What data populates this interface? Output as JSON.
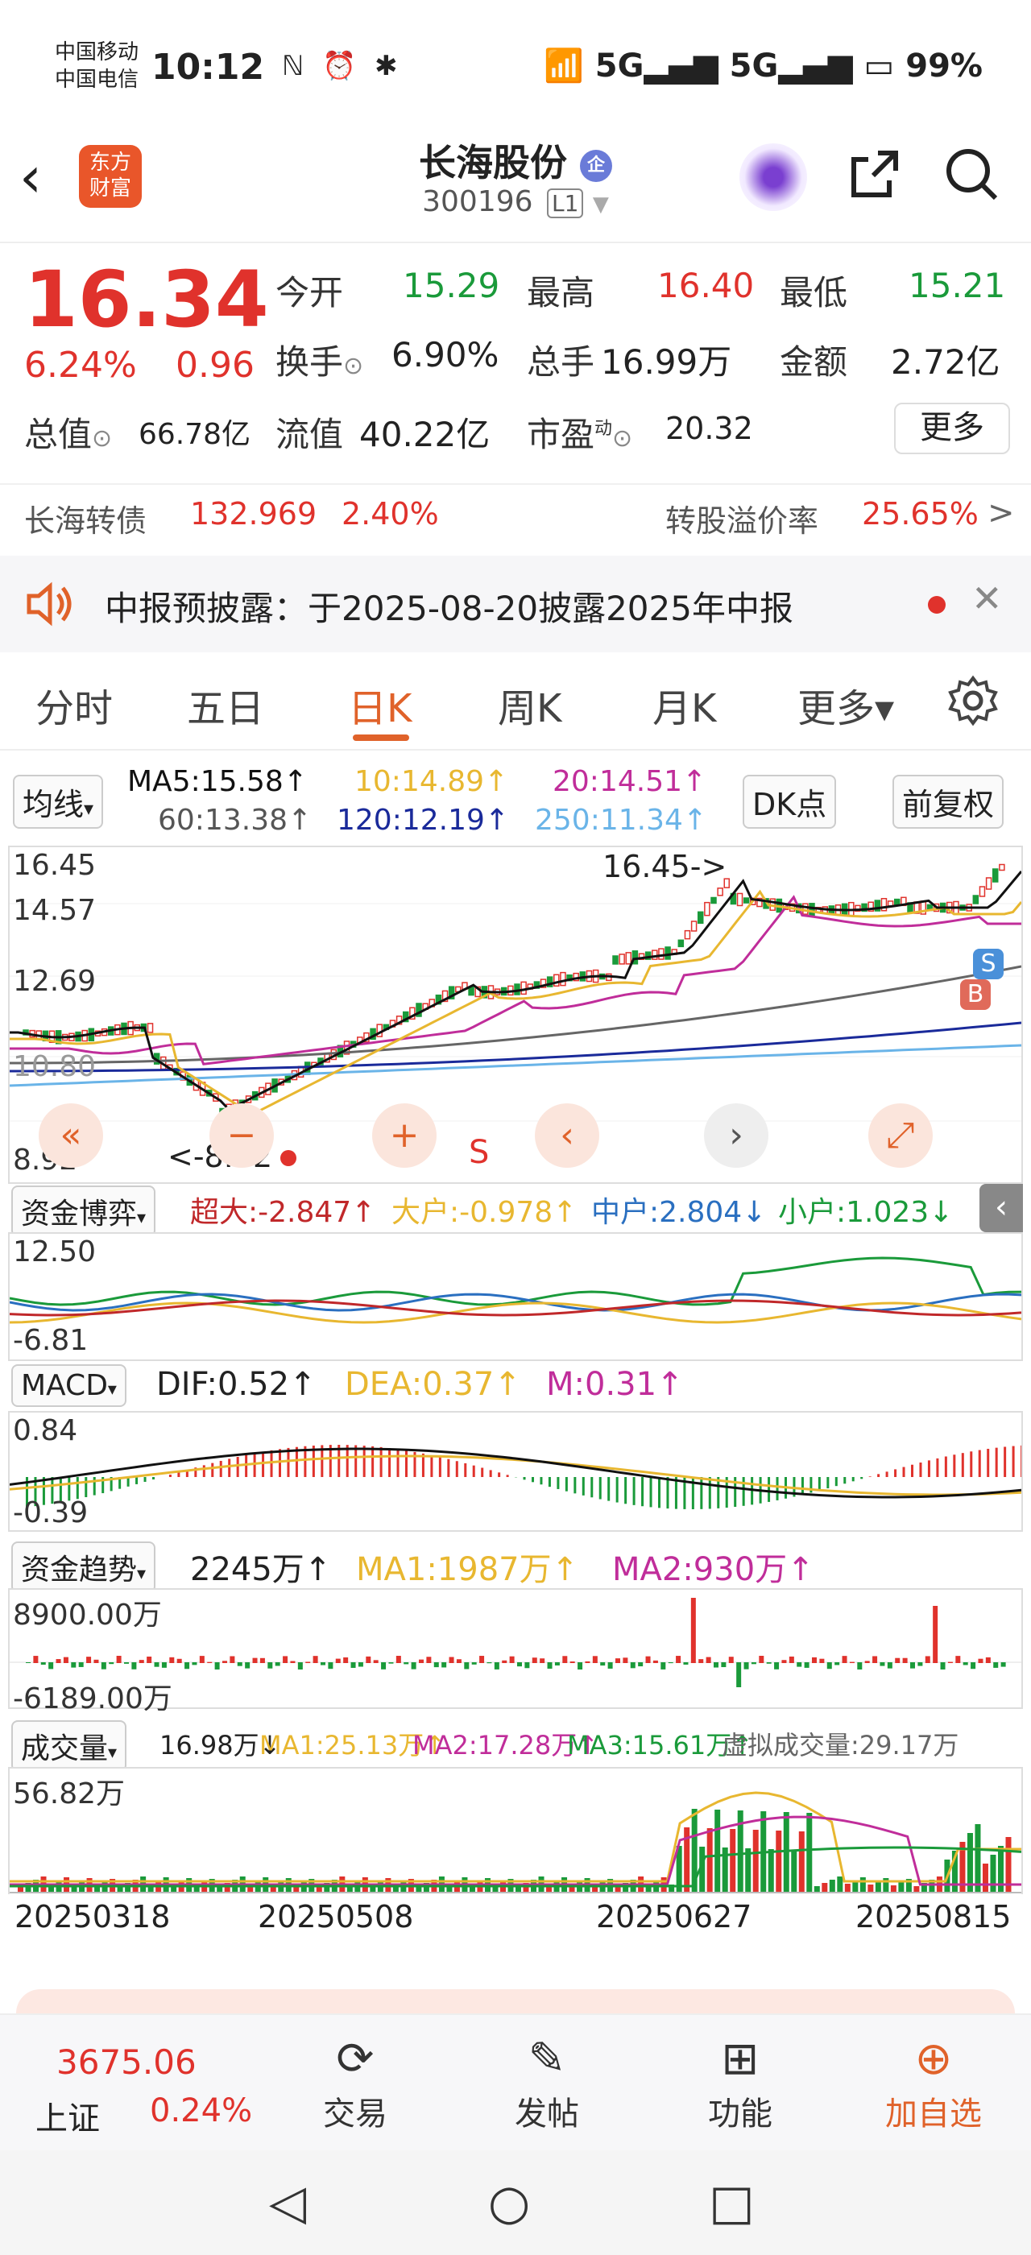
{
  "status_bar": {
    "carrier1": "中国移动",
    "carrier2": "中国电信",
    "time": "10:12",
    "left_icons": "ℕ ⏰ ✱",
    "right": "📶 5G▂▄▆ 5G▂▄▆ ▭ 99%"
  },
  "header": {
    "back_icon": "chevron-left",
    "logo_line1": "东方",
    "logo_line2": "财富",
    "stock_name": "长海股份",
    "badge": "企",
    "code": "300196",
    "level": "L1",
    "share_icon": "share-icon",
    "search_icon": "search-icon"
  },
  "quote": {
    "price": "16.34",
    "change_pct": "6.24%",
    "change_amt": "0.96",
    "open_label": "今开",
    "open": "15.29",
    "high_label": "最高",
    "high": "16.40",
    "low_label": "最低",
    "low": "15.21",
    "turnover_label": "换手",
    "turnover": "6.90%",
    "volume_label": "总手",
    "volume": "16.99万",
    "amount_label": "金额",
    "amount": "2.72亿",
    "mktcap_label": "总值",
    "mktcap": "66.78亿",
    "float_label": "流值",
    "float": "40.22亿",
    "pe_label": "市盈",
    "pe_sup": "动",
    "pe": "20.32",
    "more": "更多"
  },
  "bond": {
    "name": "长海转债",
    "price": "132.969",
    "pct": "2.40%",
    "premium_label": "转股溢价率",
    "premium": "25.65%",
    "arrow": ">"
  },
  "notice": {
    "text": "中报预披露：于2025-08-20披露2025年中报",
    "close": "✕"
  },
  "tabs": [
    "分时",
    "五日",
    "日K",
    "周K",
    "月K",
    "更多▾"
  ],
  "settings_icon": "gear-icon",
  "ma": {
    "dropdown": "均线",
    "ma5": "MA5:15.58↑",
    "ma10": "10:14.89↑",
    "ma20": "20:14.51↑",
    "ma60": "60:13.38↑",
    "ma120": "120:12.19↑",
    "ma250": "250:11.34↑",
    "dk": "DK点",
    "adjust": "前复权"
  },
  "kline": {
    "y_labels": [
      "16.45",
      "14.57",
      "12.69",
      "10.80",
      "8.92"
    ],
    "max_marker": "16.45->",
    "min_marker": "<-8.92",
    "s_mark": "S",
    "b_mark": "B",
    "s_badge": "S"
  },
  "capital_game": {
    "dropdown": "资金博弈",
    "super": "超大:-2.847↑",
    "big": "大户:-0.978↑",
    "mid": "中户:2.804↓",
    "small": "小户:1.023↓",
    "y_top": "12.50",
    "y_bottom": "-6.81"
  },
  "macd": {
    "dropdown": "MACD",
    "dif": "DIF:0.52↑",
    "dea": "DEA:0.37↑",
    "m": "M:0.31↑",
    "y_top": "0.84",
    "y_bottom": "-0.39"
  },
  "capital_trend": {
    "dropdown": "资金趋势",
    "value": "2245万↑",
    "ma1": "MA1:1987万↑",
    "ma2": "MA2:930万↑",
    "y_top": "8900.00万",
    "y_bottom": "-6189.00万"
  },
  "volume_panel": {
    "dropdown": "成交量",
    "vol": "16.98万↓",
    "ma1": "MA1:25.13万↑",
    "ma2": "MA2:17.28万↑",
    "ma3": "MA3:15.61万↑",
    "virtual": "虚拟成交量:29.17万",
    "y_top": "56.82万"
  },
  "dates": [
    "20250318",
    "20250508",
    "20250627",
    "20250815"
  ],
  "bottom_bar": {
    "index_value": "3675.06",
    "index_name": "上证",
    "index_pct": "0.24%",
    "trade": "交易",
    "post": "发帖",
    "func": "功能",
    "add": "加自选"
  },
  "colors": {
    "red": "#e0322c",
    "green": "#1a9a3a",
    "accent": "#e0622a",
    "ma5": "#111111",
    "ma10": "#e8b730",
    "ma20": "#c02d9a",
    "ma60": "#666666",
    "ma120": "#1a2a9a",
    "ma250": "#6ab4e8"
  }
}
